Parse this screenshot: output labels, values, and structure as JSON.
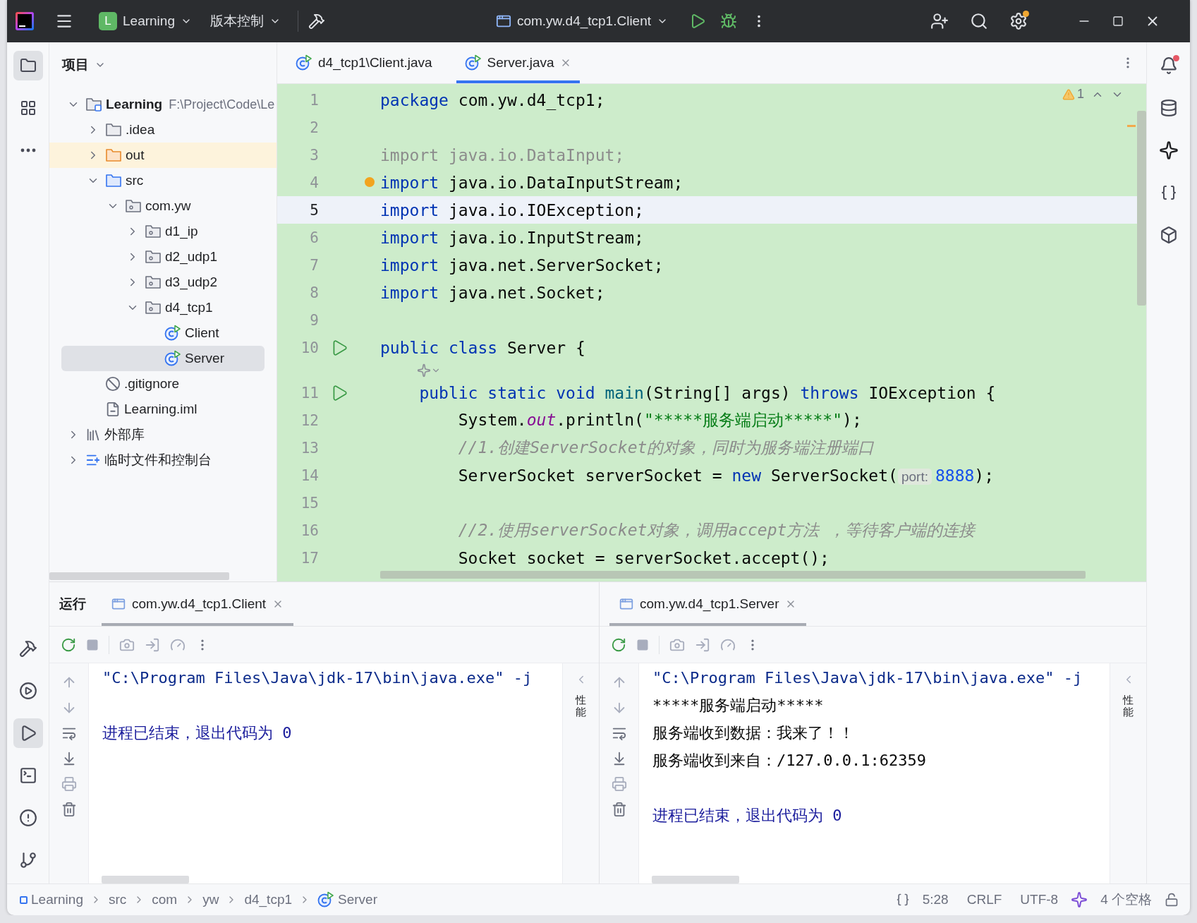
{
  "title_bar": {
    "project_badge": "L",
    "project": "Learning",
    "vcs": "版本控制",
    "run_config": "com.yw.d4_tcp1.Client",
    "notifications_dot": true
  },
  "project_panel": {
    "title": "项目",
    "tree": [
      {
        "label": "Learning",
        "detail": "F:\\Project\\Code\\Le",
        "kind": "project",
        "expanded": true,
        "selected": false,
        "children": [
          {
            "label": ".idea",
            "kind": "folder",
            "expanded": false,
            "selected": false
          },
          {
            "label": "out",
            "kind": "excluded",
            "expanded": false,
            "selected": false
          },
          {
            "label": "src",
            "kind": "source",
            "expanded": true,
            "selected": false,
            "children": [
              {
                "label": "com.yw",
                "kind": "package",
                "expanded": true,
                "selected": false,
                "children": [
                  {
                    "label": "d1_ip",
                    "kind": "package",
                    "expanded": false,
                    "selected": false
                  },
                  {
                    "label": "d2_udp1",
                    "kind": "package",
                    "expanded": false,
                    "selected": false
                  },
                  {
                    "label": "d3_udp2",
                    "kind": "package",
                    "expanded": false,
                    "selected": false
                  },
                  {
                    "label": "d4_tcp1",
                    "kind": "package",
                    "expanded": true,
                    "selected": false,
                    "children": [
                      {
                        "label": "Client",
                        "kind": "class",
                        "selected": false
                      },
                      {
                        "label": "Server",
                        "kind": "class",
                        "selected": true
                      }
                    ]
                  }
                ]
              }
            ]
          },
          {
            "label": ".gitignore",
            "kind": "ignore",
            "selected": false
          },
          {
            "label": "Learning.iml",
            "kind": "file",
            "selected": false
          }
        ]
      },
      {
        "label": "外部库",
        "kind": "library",
        "expanded": false,
        "selected": false
      },
      {
        "label": "临时文件和控制台",
        "kind": "scratch",
        "expanded": false,
        "selected": false
      }
    ]
  },
  "editor": {
    "tabs": [
      {
        "label": "d4_tcp1\\Client.java",
        "selected": false
      },
      {
        "label": "Server.java",
        "selected": true
      }
    ],
    "warning_count": "1",
    "lines": [
      {
        "number": "1",
        "tokens": [
          {
            "kind": "keyword",
            "text": "package"
          },
          {
            "kind": "plain",
            "text": " com.yw.d4_tcp1;"
          }
        ]
      },
      {
        "number": "2"
      },
      {
        "number": "3",
        "tokens": [
          {
            "kind": "unused",
            "text": "import java.io.DataInput;"
          }
        ]
      },
      {
        "number": "4",
        "bulb": true,
        "tokens": [
          {
            "kind": "keyword",
            "text": "import"
          },
          {
            "kind": "plain",
            "text": " java.io.DataInputStream;"
          }
        ]
      },
      {
        "number": "5",
        "current": true,
        "tokens": [
          {
            "kind": "keyword",
            "text": "import"
          },
          {
            "kind": "plain",
            "text": " java.io.IOException;"
          }
        ]
      },
      {
        "number": "6",
        "tokens": [
          {
            "kind": "keyword",
            "text": "import"
          },
          {
            "kind": "plain",
            "text": " java.io.InputStream;"
          }
        ]
      },
      {
        "number": "7",
        "tokens": [
          {
            "kind": "keyword",
            "text": "import"
          },
          {
            "kind": "plain",
            "text": " java.net.ServerSocket;"
          }
        ]
      },
      {
        "number": "8",
        "tokens": [
          {
            "kind": "keyword",
            "text": "import"
          },
          {
            "kind": "plain",
            "text": " java.net.Socket;"
          }
        ]
      },
      {
        "number": "9"
      },
      {
        "number": "10",
        "run": true,
        "ai_hint": true,
        "tokens": [
          {
            "kind": "keyword",
            "text": "public class"
          },
          {
            "kind": "plain",
            "text": " Server {"
          }
        ]
      },
      {
        "number": "11",
        "run": true,
        "tokens": [
          {
            "kind": "keyword",
            "text": "    public static void"
          },
          {
            "kind": "method",
            "text": " main"
          },
          {
            "kind": "plain",
            "text": "(String[] args) "
          },
          {
            "kind": "keyword",
            "text": "throws"
          },
          {
            "kind": "plain",
            "text": " IOException {"
          }
        ]
      },
      {
        "number": "12",
        "tokens": [
          {
            "kind": "plain",
            "text": "        System."
          },
          {
            "kind": "field",
            "text": "out"
          },
          {
            "kind": "plain",
            "text": ".println("
          },
          {
            "kind": "string",
            "text": "\"*****服务端启动*****\""
          },
          {
            "kind": "plain",
            "text": ");"
          }
        ]
      },
      {
        "number": "13",
        "tokens": [
          {
            "kind": "comment",
            "text": "        //1.创建ServerSocket的对象，同时为服务端注册端口"
          }
        ]
      },
      {
        "number": "14",
        "tokens": [
          {
            "kind": "plain",
            "text": "        ServerSocket serverSocket = "
          },
          {
            "kind": "keyword",
            "text": "new"
          },
          {
            "kind": "plain",
            "text": " ServerSocket("
          },
          {
            "kind": "hint",
            "text": "port:"
          },
          {
            "kind": "number",
            "text": "8888"
          },
          {
            "kind": "plain",
            "text": ");"
          }
        ]
      },
      {
        "number": "15"
      },
      {
        "number": "16",
        "tokens": [
          {
            "kind": "comment",
            "text": "        //2.使用serverSocket对象，调用accept方法 ，等待客户端的连接"
          }
        ]
      },
      {
        "number": "17",
        "tokens": [
          {
            "kind": "plain",
            "text": "        Socket socket = serverSocket.accept();"
          }
        ]
      }
    ]
  },
  "run_panel": {
    "title": "运行",
    "panes": [
      {
        "tab": "com.yw.d4_tcp1.Client",
        "selected": true,
        "lines": [
          {
            "kind": "command",
            "text": "\"C:\\Program Files\\Java\\jdk-17\\bin\\java.exe\" -j"
          },
          {
            "kind": "exit",
            "text": "进程已结束，退出代码为 0"
          }
        ],
        "rail_label": "性能"
      },
      {
        "tab": "com.yw.d4_tcp1.Server",
        "selected": true,
        "lines": [
          {
            "kind": "command",
            "text": "\"C:\\Program Files\\Java\\jdk-17\\bin\\java.exe\" -j"
          },
          {
            "kind": "output",
            "text": "*****服务端启动*****"
          },
          {
            "kind": "output",
            "text": "服务端收到数据：我来了！！"
          },
          {
            "kind": "output",
            "text": "服务端收到来自：/127.0.0.1:62359"
          },
          {
            "kind": "exit",
            "text": "进程已结束，退出代码为 0"
          }
        ],
        "rail_label": "性能"
      }
    ]
  },
  "status_bar": {
    "breadcrumbs": [
      {
        "label": "Learning",
        "kind": "module"
      },
      {
        "label": "src",
        "kind": "plain"
      },
      {
        "label": "com",
        "kind": "plain"
      },
      {
        "label": "yw",
        "kind": "plain"
      },
      {
        "label": "d4_tcp1",
        "kind": "plain"
      },
      {
        "label": "Server",
        "kind": "class"
      }
    ],
    "position": "5:28",
    "line_separator": "CRLF",
    "encoding": "UTF-8",
    "indent": "4 个空格"
  }
}
